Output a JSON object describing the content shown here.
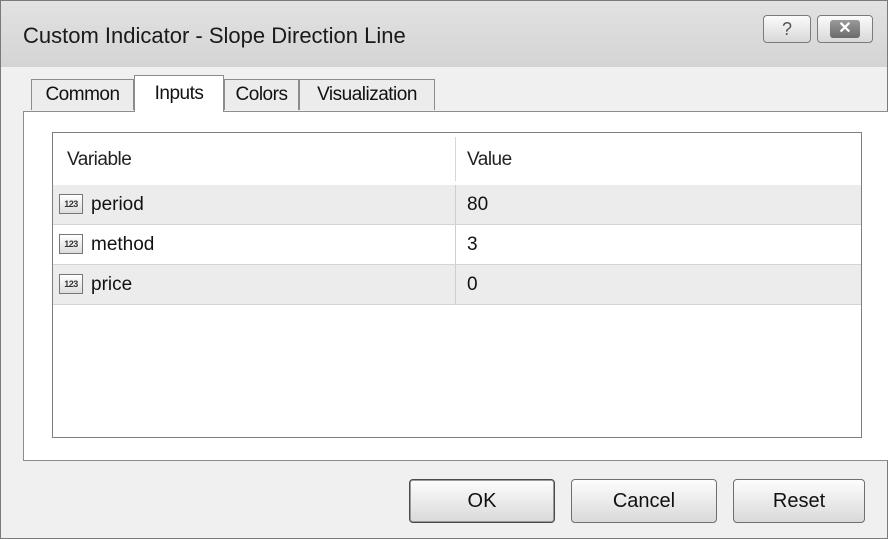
{
  "window": {
    "title": "Custom Indicator - Slope Direction Line",
    "help_label": "?",
    "close_label": "✕"
  },
  "tabs": [
    {
      "label": "Common",
      "active": false
    },
    {
      "label": "Inputs",
      "active": true
    },
    {
      "label": "Colors",
      "active": false
    },
    {
      "label": "Visualization",
      "active": false
    }
  ],
  "inputs_table": {
    "columns": [
      "Variable",
      "Value"
    ],
    "rows": [
      {
        "icon": "numeric-123-icon",
        "icon_text": "123",
        "variable": "period",
        "value": "80"
      },
      {
        "icon": "numeric-123-icon",
        "icon_text": "123",
        "variable": "method",
        "value": "3"
      },
      {
        "icon": "numeric-123-icon",
        "icon_text": "123",
        "variable": "price",
        "value": "0"
      }
    ]
  },
  "buttons": {
    "ok": "OK",
    "cancel": "Cancel",
    "reset": "Reset"
  }
}
